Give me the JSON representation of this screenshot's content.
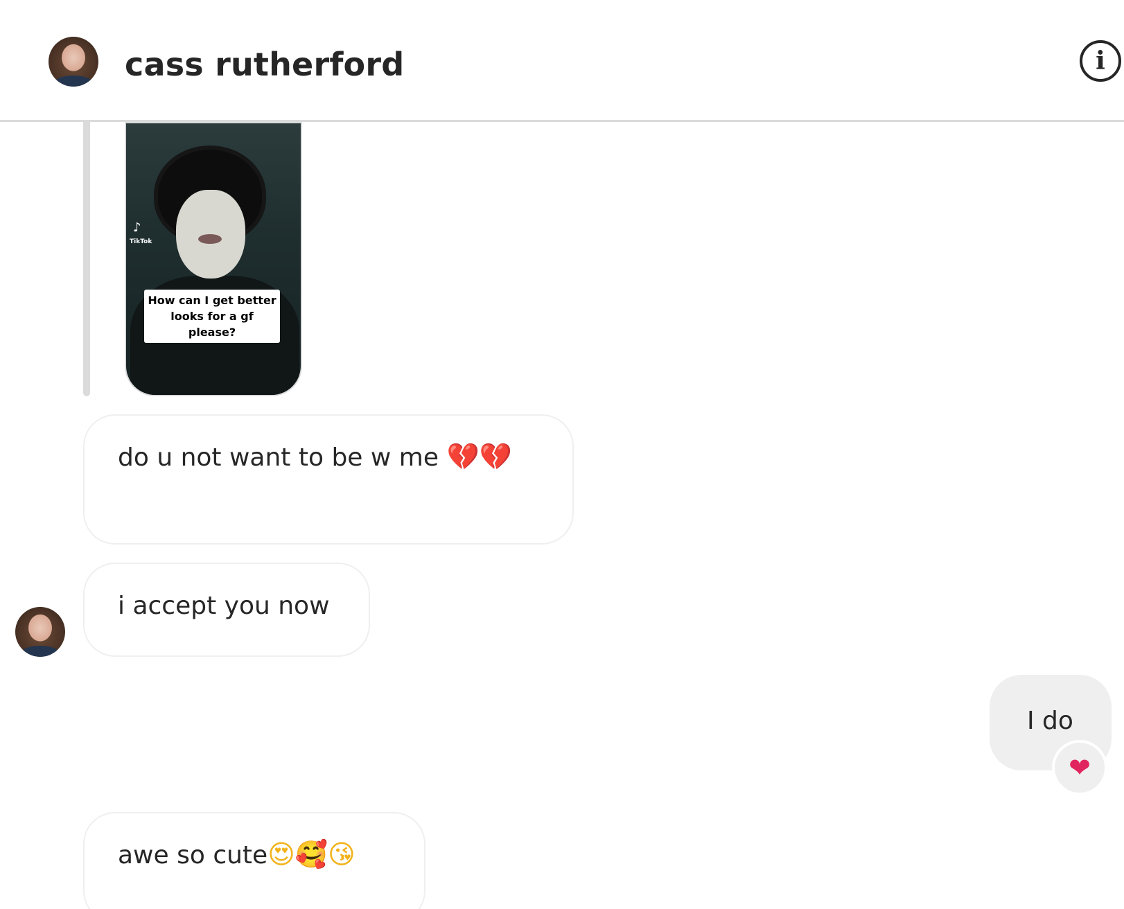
{
  "header": {
    "title": "cass rutherford",
    "info_icon": "i"
  },
  "shared_media": {
    "tiktok_label": "TikTok",
    "tiktok_logo": "♪",
    "caption": "How can I get better looks for a gf please?"
  },
  "messages": [
    {
      "sender": "them",
      "text": "do u not want to be w me",
      "emojis": "💔💔"
    },
    {
      "sender": "them",
      "text": "i accept you now"
    },
    {
      "sender": "me",
      "text": "I do",
      "reaction": "❤"
    },
    {
      "sender": "them",
      "text": "awe so cute",
      "emojis": "😍🥰😘"
    }
  ],
  "colors": {
    "bubble_border": "#efefef",
    "my_bubble_bg": "#efefef",
    "text": "#262626",
    "divider": "#dbdbdb"
  },
  "icons": {
    "header_avatar": "avatar-icon",
    "info": "info-icon",
    "broken_heart": "broken-heart-icon",
    "heart": "heart-icon"
  }
}
